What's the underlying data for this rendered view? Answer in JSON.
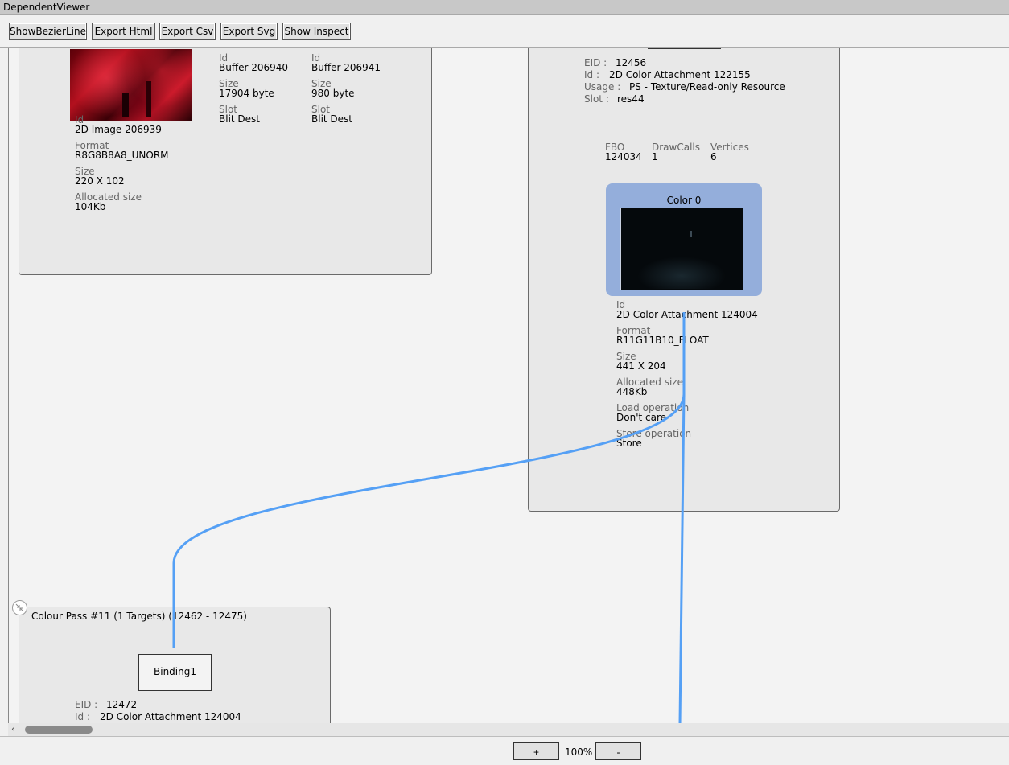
{
  "window": {
    "title": "DependentViewer"
  },
  "toolbar": {
    "show_bezier": "ShowBezierLine",
    "export_html": "Export Html",
    "export_csv": "Export Csv",
    "export_svg": "Export Svg",
    "show_inspect": "Show Inspect"
  },
  "labels": {
    "id": "Id",
    "format": "Format",
    "size": "Size",
    "allocated": "Allocated size",
    "slot": "Slot",
    "load_op": "Load operation",
    "store_op": "Store operation",
    "eid": "EID :",
    "id_colon": "Id :",
    "usage": "Usage :",
    "slot_colon": "Slot :",
    "fbo": "FBO",
    "drawcalls": "DrawCalls",
    "vertices": "Vertices"
  },
  "node1": {
    "image": {
      "id": "2D Image 206939",
      "format": "R8G8B8A8_UNORM",
      "size": "220 X 102",
      "allocated": "104Kb"
    },
    "buffers": [
      {
        "id": "Buffer 206940",
        "size": "17904 byte",
        "slot": "Blit Dest"
      },
      {
        "id": "Buffer 206941",
        "size": "980 byte",
        "slot": "Blit Dest"
      }
    ]
  },
  "node2": {
    "binding": {
      "eid": "12456",
      "id": "2D Color Attachment 122155",
      "usage": "PS - Texture/Read-only Resource",
      "slot": "res44"
    },
    "fbo": "124034",
    "drawcalls": "1",
    "vertices": "6",
    "attachment": {
      "title": "Color 0",
      "id": "2D Color Attachment 124004",
      "format": "R11G11B10_FLOAT",
      "size": "441 X 204",
      "allocated": "448Kb",
      "load_op": "Don't care",
      "store_op": "Store"
    }
  },
  "node3": {
    "title": "Colour Pass #11 (1 Targets) (12462 - 12475)",
    "binding_label": "Binding1",
    "eid": "12472",
    "id": "2D Color Attachment 124004"
  },
  "zoom": {
    "plus": "+",
    "level": "100%",
    "minus": "-"
  },
  "colors": {
    "edge": "#55a0f5",
    "attachment_bg": "#94aedb"
  }
}
